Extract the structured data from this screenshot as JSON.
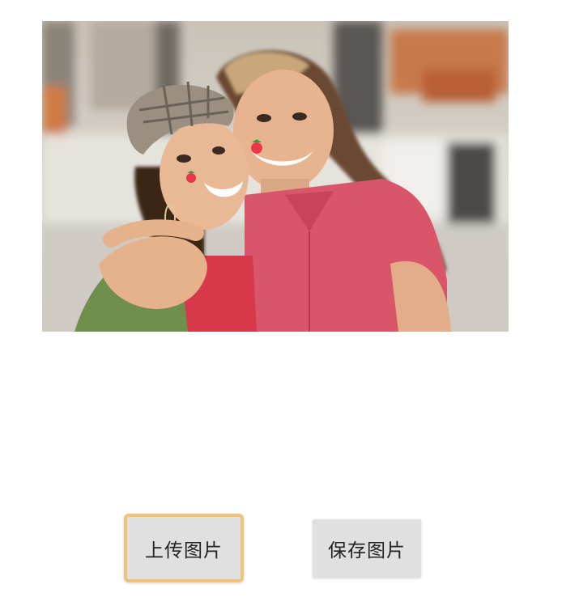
{
  "photo": {
    "subject": "two-women-selfie",
    "sticker_icon": "strawberry-icon"
  },
  "buttons": {
    "upload_label": "上传图片",
    "save_label": "保存图片",
    "focus_border_color": "#f0c27a",
    "background_color": "#e0e0e0"
  }
}
